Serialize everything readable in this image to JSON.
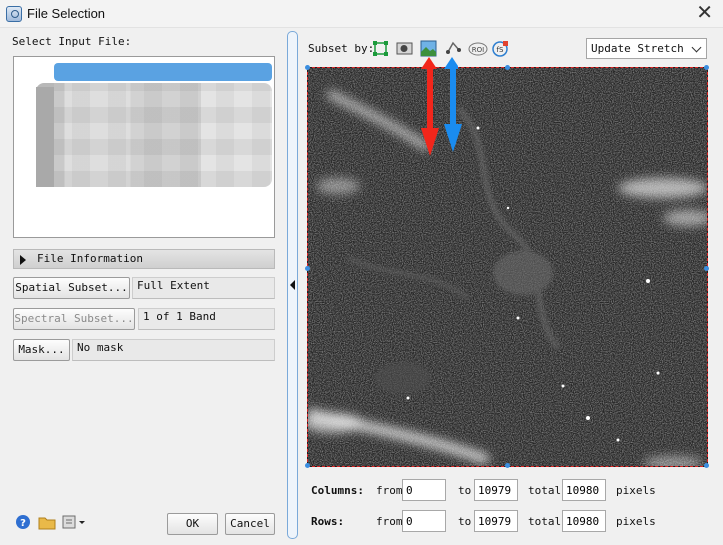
{
  "window": {
    "title": "File Selection"
  },
  "left": {
    "select_label": "Select Input File:",
    "file_info_label": "File Information",
    "spatial_button": "Spatial Subset...",
    "spatial_value": "Full Extent",
    "spectral_button": "Spectral Subset...",
    "spectral_value": "1 of 1 Band",
    "mask_button": "Mask...",
    "mask_value": "No mask",
    "ok_button": "OK",
    "cancel_button": "Cancel"
  },
  "right": {
    "subset_label": "Subset by:",
    "stretch_select": "Update Stretch",
    "tools": [
      "image-extent-icon",
      "view-icon",
      "image-icon",
      "vector-icon",
      "roi-icon",
      "file-icon"
    ],
    "colors": {
      "red_arrow": "#f2261b",
      "blue_arrow": "#1a8cf0",
      "extent_border": "#e02424",
      "handle": "#3b8ee0"
    }
  },
  "coords": {
    "columns_label": "Columns:",
    "rows_label": "Rows:",
    "from_label": "from",
    "to_label": "to",
    "total_label": "total",
    "pixels_label": "pixels",
    "columns_from": "0",
    "columns_to": "10979",
    "columns_total": "10980",
    "rows_from": "0",
    "rows_to": "10979",
    "rows_total": "10980"
  }
}
